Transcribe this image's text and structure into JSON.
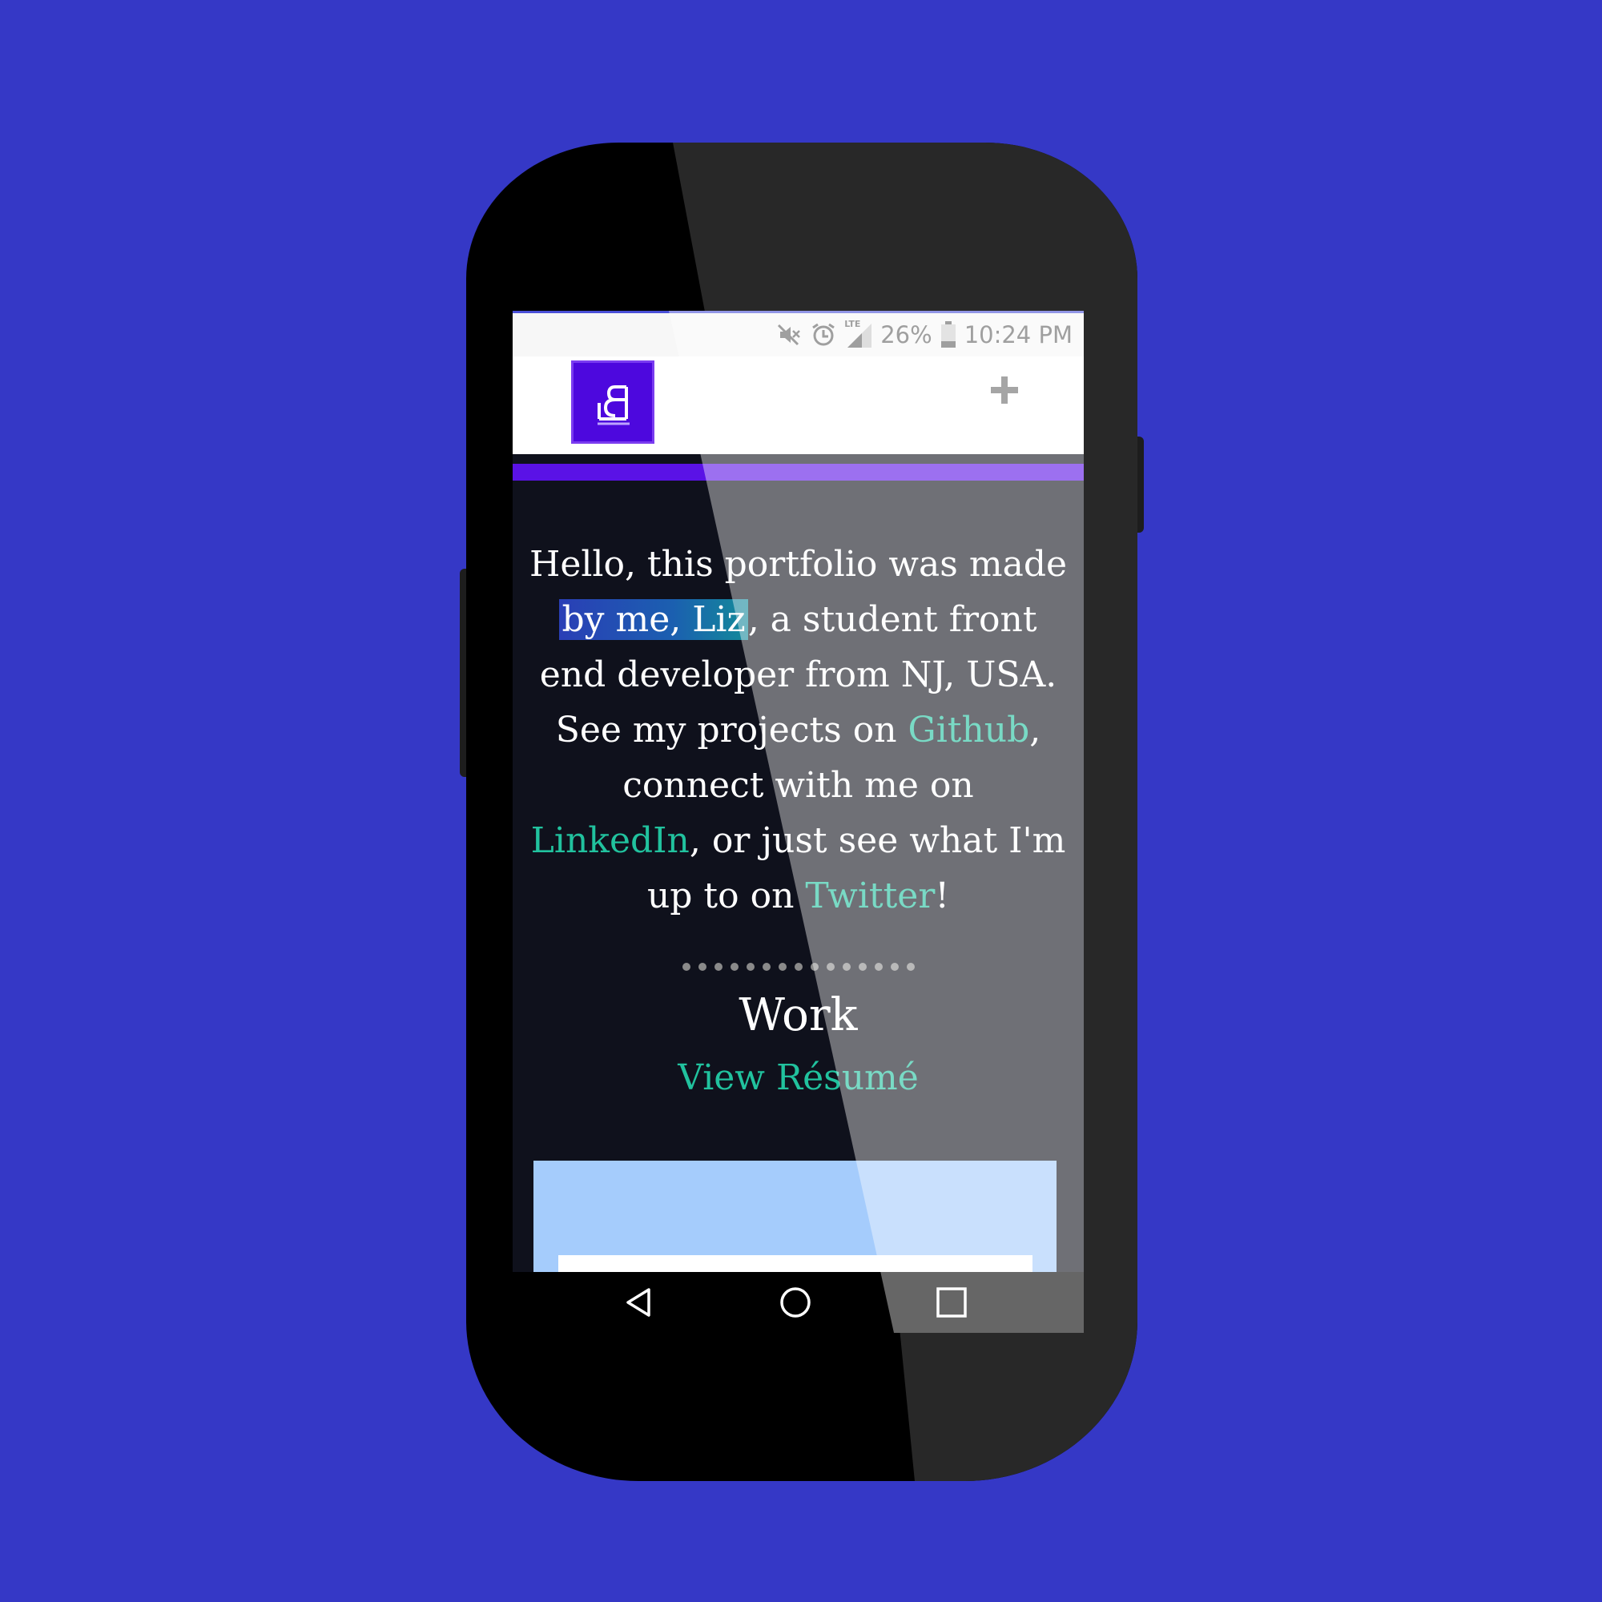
{
  "colors": {
    "background": "#3538c6",
    "brand_purple": "#5a12e6",
    "link_teal": "#21c29e",
    "screen_dark": "#0f111c"
  },
  "statusbar": {
    "icons": [
      "mute-icon",
      "alarm-icon",
      "lte-signal-icon",
      "battery-icon"
    ],
    "lte_label": "LTE",
    "battery_percent": "26%",
    "time": "10:24 PM"
  },
  "header": {
    "logo_text": "LB",
    "menu_icon": "plus-icon"
  },
  "intro": {
    "line1": "Hello, this portfolio was made",
    "highlight": "by me, Liz",
    "line2_rest": ", a student front",
    "line3": "end developer from NJ, USA.",
    "line4_pre": "See my projects on ",
    "github_link": "Github",
    "line4_post": ",",
    "line5": "connect with me on",
    "linkedin_link": "LinkedIn",
    "line6_post": ", or just see what I'm",
    "line7_pre": "up to on ",
    "twitter_link": "Twitter",
    "line7_post": "!"
  },
  "work": {
    "title": "Work",
    "resume_link": "View Résumé"
  },
  "navbar": {
    "back_icon": "back-triangle-icon",
    "home_icon": "home-circle-icon",
    "recents_icon": "recents-square-icon"
  }
}
